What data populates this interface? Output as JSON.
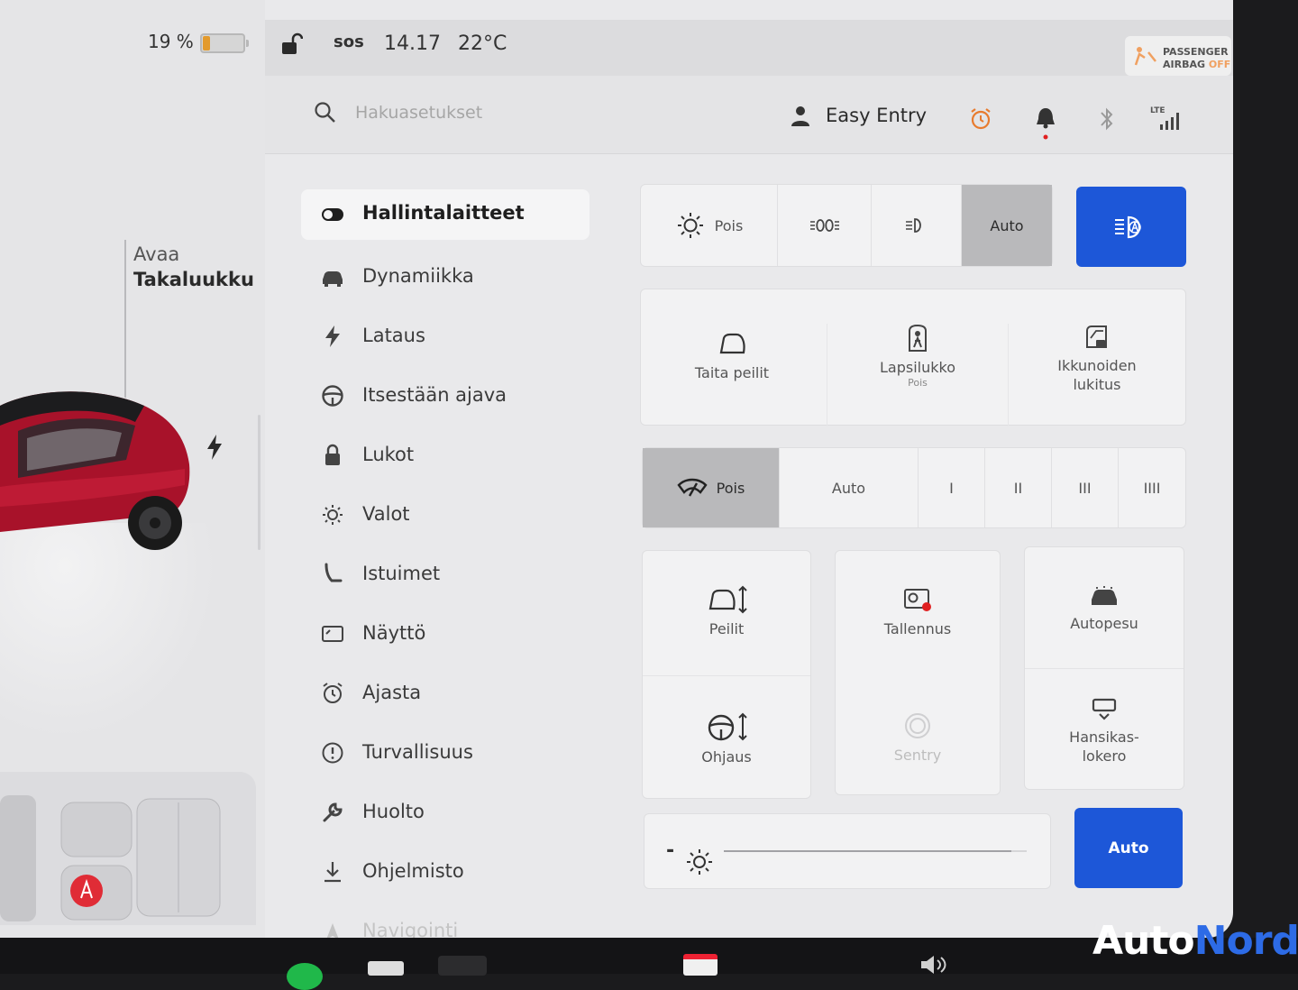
{
  "status": {
    "battery_percent": "19 %",
    "battery_level": 0.19,
    "sos_label": "sos",
    "time": "14.17",
    "temperature": "22°C",
    "airbag_line1": "PASSENGER",
    "airbag_line2": "AIRBAG",
    "airbag_state": "OFF"
  },
  "car": {
    "trunk_line1": "Avaa",
    "trunk_line2": "Takaluukku"
  },
  "header": {
    "search_placeholder": "Hakuasetukset",
    "profile_name": "Easy Entry",
    "lte_label": "LTE"
  },
  "nav": {
    "items": [
      {
        "label": "Hallintalaitteet",
        "icon": "toggle-icon"
      },
      {
        "label": "Dynamiikka",
        "icon": "car-icon"
      },
      {
        "label": "Lataus",
        "icon": "lightning-icon"
      },
      {
        "label": "Itsestään ajava",
        "icon": "steering-wheel-icon"
      },
      {
        "label": "Lukot",
        "icon": "lock-icon"
      },
      {
        "label": "Valot",
        "icon": "light-icon"
      },
      {
        "label": "Istuimet",
        "icon": "seat-icon"
      },
      {
        "label": "Näyttö",
        "icon": "display-icon"
      },
      {
        "label": "Ajasta",
        "icon": "alarm-icon"
      },
      {
        "label": "Turvallisuus",
        "icon": "alert-icon"
      },
      {
        "label": "Huolto",
        "icon": "wrench-icon"
      },
      {
        "label": "Ohjelmisto",
        "icon": "download-icon"
      },
      {
        "label": "Navigointi",
        "icon": "navigation-icon"
      }
    ]
  },
  "lights": {
    "off_label": "Pois",
    "auto_label": "Auto",
    "selected": "Auto"
  },
  "tiles_row1": {
    "fold_mirrors": "Taita peilit",
    "child_lock": "Lapsilukko",
    "child_lock_state": "Pois",
    "window_lock_line1": "Ikkunoiden",
    "window_lock_line2": "lukitus"
  },
  "wipers": {
    "off_label": "Pois",
    "auto_label": "Auto",
    "speeds": [
      "I",
      "II",
      "III",
      "IIII"
    ],
    "selected": "Pois"
  },
  "tiles_grid": {
    "mirrors": "Peilit",
    "recording": "Tallennus",
    "car_wash": "Autopesu",
    "steering": "Ohjaus",
    "sentry": "Sentry",
    "glovebox_line1": "Hansikas-",
    "glovebox_line2": "lokero"
  },
  "brightness": {
    "minus": "-",
    "level": 0.95,
    "auto_label": "Auto"
  },
  "watermark": {
    "part1": "Auto",
    "part2": "Nord"
  },
  "colors": {
    "accent_blue": "#1d57d8",
    "battery_orange": "#e39a2d",
    "car_red": "#b0142a",
    "recording_dot": "#e02020"
  }
}
